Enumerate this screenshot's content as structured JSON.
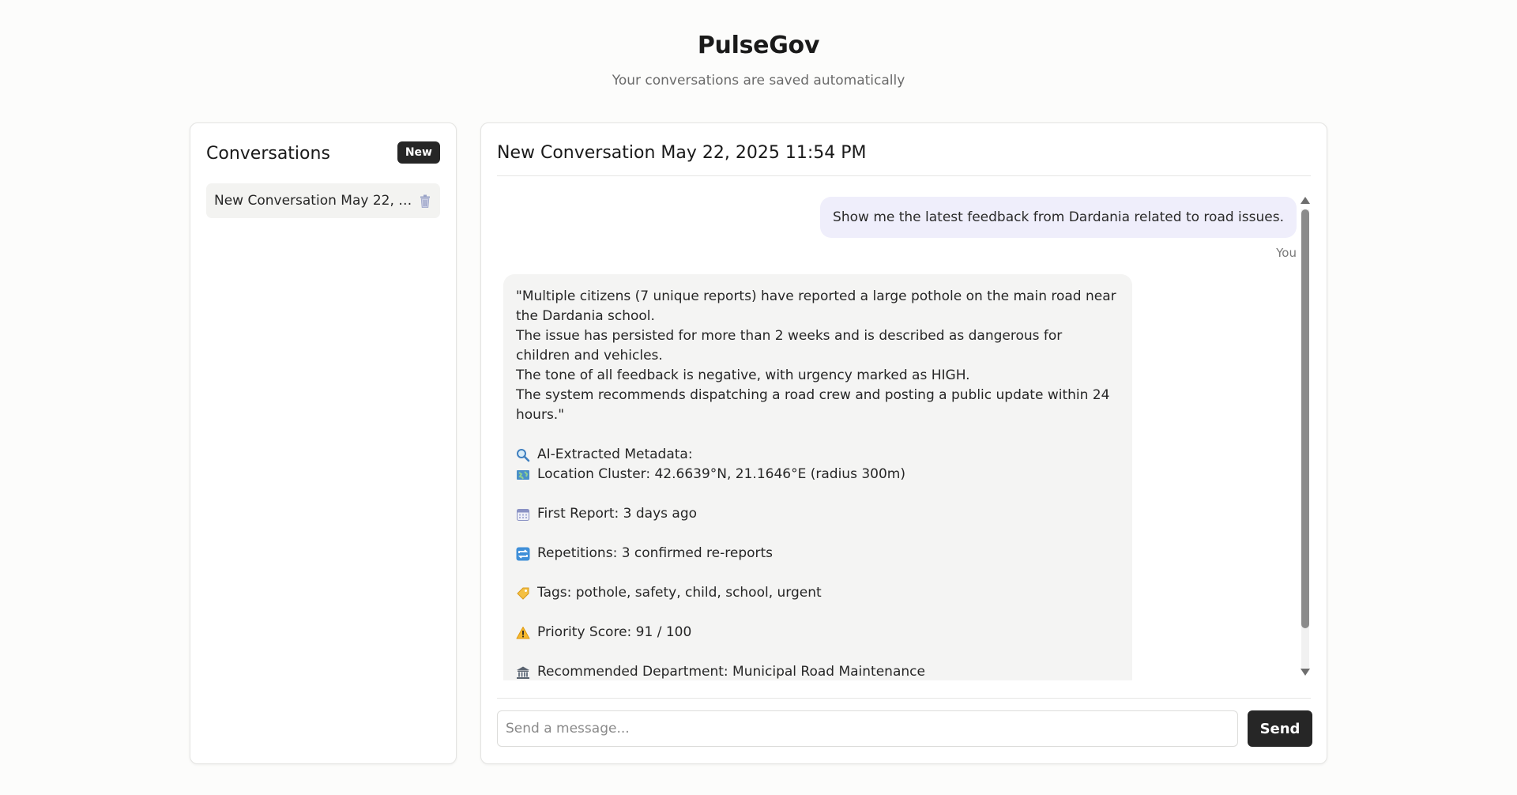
{
  "app": {
    "title": "PulseGov",
    "subtitle": "Your conversations are saved automatically"
  },
  "sidebar": {
    "title": "Conversations",
    "new_label": "New",
    "conversations": [
      {
        "label": "New Conversation May 22, 2025 11:54 PM",
        "icon": "trash-icon"
      }
    ]
  },
  "chat": {
    "title": "New Conversation May 22, 2025 11:54 PM",
    "user_message": {
      "text": "Show me the latest feedback from Dardania related to road issues.",
      "sender": "You"
    },
    "bot_message": {
      "summary_lines": [
        "\"Multiple citizens (7 unique reports) have reported a large pothole on the main road near the Dardania school.",
        "The issue has persisted for more than 2 weeks and is described as dangerous for children and vehicles.",
        "The tone of all feedback is negative, with urgency marked as HIGH.",
        "The system recommends dispatching a road crew and posting a public update within 24 hours.\""
      ],
      "metadata_heading": "AI-Extracted Metadata:",
      "metadata": [
        {
          "icon": "map-icon",
          "text": "Location Cluster: 42.6639°N, 21.1646°E (radius 300m)"
        },
        {
          "icon": "calendar-icon",
          "text": "First Report: 3 days ago"
        },
        {
          "icon": "repeat-icon",
          "text": "Repetitions: 3 confirmed re-reports"
        },
        {
          "icon": "tag-icon",
          "text": "Tags: pothole, safety, child, school, urgent"
        },
        {
          "icon": "warning-icon",
          "text": "Priority Score: 91 / 100"
        },
        {
          "icon": "government-building-icon",
          "text": "Recommended Department: Municipal Road Maintenance"
        }
      ]
    },
    "input_placeholder": "Send a message...",
    "send_label": "Send"
  },
  "colors": {
    "accent_dark": "#262626",
    "user_bubble": "#efeefb",
    "bot_bubble": "#f4f4f3"
  }
}
